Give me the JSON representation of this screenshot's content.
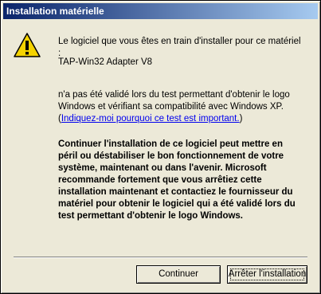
{
  "window": {
    "title": "Installation matérielle"
  },
  "message": {
    "line1": "Le logiciel que vous êtes en train d'installer pour ce matériel :",
    "device_name": "TAP-Win32 Adapter V8",
    "not_validated_text": "n'a pas été validé lors du test permettant d'obtenir le logo Windows et vérifiant sa compatibilité avec Windows XP. (",
    "why_link": "Indiquez-moi pourquoi ce test est important.",
    "not_validated_suffix": ")",
    "warning_bold": "Continuer l'installation de ce logiciel peut mettre en péril ou déstabiliser le bon fonctionnement de votre système, maintenant ou dans l'avenir. Microsoft recommande fortement que vous arrêtiez cette installation maintenant et contactiez le fournisseur du matériel pour obtenir le logiciel qui a été validé lors du test permettant d'obtenir le logo Windows."
  },
  "buttons": {
    "continue_label": "Continuer",
    "stop_label": "Arrêter l'installation"
  },
  "icons": {
    "warning": "warning-icon"
  },
  "colors": {
    "titlebar_start": "#0a246a",
    "titlebar_end": "#a6caf0",
    "link": "#0000ee",
    "dialog_bg": "#ece9d8"
  }
}
